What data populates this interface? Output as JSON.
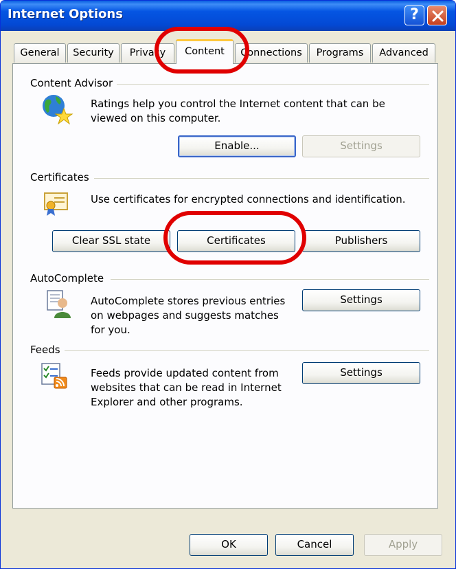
{
  "window": {
    "title": "Internet Options",
    "help_glyph": "?"
  },
  "tabs": [
    {
      "label": "General"
    },
    {
      "label": "Security"
    },
    {
      "label": "Privacy"
    },
    {
      "label": "Content"
    },
    {
      "label": "Connections"
    },
    {
      "label": "Programs"
    },
    {
      "label": "Advanced"
    }
  ],
  "active_tab": "Content",
  "content_advisor": {
    "label": "Content Advisor",
    "desc_line1": "Ratings help you control the Internet content that can be",
    "desc_line2": "viewed on this computer.",
    "enable_button": "Enable...",
    "settings_button": "Settings"
  },
  "certificates": {
    "label": "Certificates",
    "desc": "Use certificates for encrypted connections and identification.",
    "clear_ssl_button": "Clear SSL state",
    "certificates_button": "Certificates",
    "publishers_button": "Publishers"
  },
  "autocomplete": {
    "label": "AutoComplete",
    "desc_line1": "AutoComplete stores previous entries",
    "desc_line2": "on webpages and suggests matches",
    "desc_line3": "for you.",
    "settings_button": "Settings"
  },
  "feeds": {
    "label": "Feeds",
    "desc_line1": "Feeds provide updated content from",
    "desc_line2": "websites that can be read in Internet",
    "desc_line3": "Explorer and other programs.",
    "settings_button": "Settings"
  },
  "footer": {
    "ok": "OK",
    "cancel": "Cancel",
    "apply": "Apply"
  },
  "colors": {
    "titlebar": "#0556e3",
    "dialog_bg": "#ece9d8",
    "highlight_ring": "#e00000",
    "active_tab_top": "#ffc83c"
  },
  "icons": [
    "help-icon",
    "close-icon",
    "globe-star-icon",
    "certificate-icon",
    "autocomplete-user-icon",
    "feeds-icon"
  ]
}
